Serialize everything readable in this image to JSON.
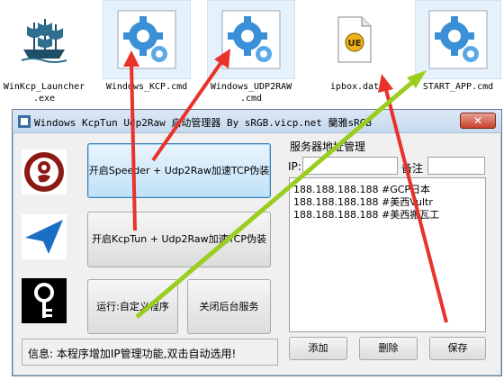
{
  "files": [
    {
      "name": "WinKcp_Launcher.exe",
      "line1": "WinKcp_Launcher",
      "line2": ".exe",
      "icon": "ship-icon"
    },
    {
      "name": "Windows_KCP.cmd",
      "line1": "Windows_KCP.cmd",
      "line2": "",
      "icon": "gear-icon"
    },
    {
      "name": "Windows_UDP2RAW.cmd",
      "line1": "Windows_UDP2RAW",
      "line2": ".cmd",
      "icon": "gear-icon"
    },
    {
      "name": "ipbox.dat",
      "line1": "ipbox.dat",
      "line2": "",
      "icon": "document-icon"
    },
    {
      "name": "START_APP.cmd",
      "line1": "START_APP.cmd",
      "line2": "",
      "icon": "gear-icon"
    }
  ],
  "window": {
    "title": "Windows KcpTun Udp2Raw 启动管理器    By sRGB.vicp.net 蘭雅sRGB",
    "close_label": "✕"
  },
  "buttons": {
    "start_speeder": "开启Speeder + Udp2Raw加速TCP伪装",
    "start_kcptun": "开启KcpTun + Udp2Raw加速TCP伪装",
    "run_custom": "运行:自定义程序",
    "close_services": "关闭后台服务",
    "add": "添加",
    "delete": "删除",
    "save": "保存"
  },
  "server_panel": {
    "title": "服务器地址管理",
    "ip_label": "IP:",
    "note_label": "备注",
    "ip_value": "",
    "note_value": ""
  },
  "servers": [
    {
      "ip": "188.188.188.188",
      "note": "#GCP日本"
    },
    {
      "ip": "188.188.188.188",
      "note": "#美西Vultr"
    },
    {
      "ip": "188.188.188.188",
      "note": "#美西搬瓦工"
    }
  ],
  "info_text": "信息: 本程序增加IP管理功能,双击自动选用!",
  "colors": {
    "red_arrow": "#e8322a",
    "green_arrow": "#9acd20",
    "wireguard_red": "#8b1a14",
    "paperplane_blue": "#1a6fc4",
    "accent_blue": "#3c7fb1"
  }
}
